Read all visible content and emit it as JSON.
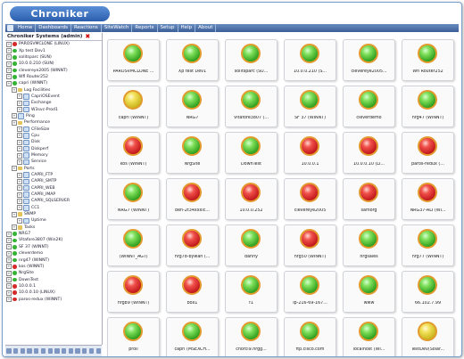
{
  "app": {
    "logo_text": "Chroniker"
  },
  "nav": {
    "items": [
      "Home",
      "Dashboards",
      "Reactions",
      "SiteWatch",
      "Reports",
      "Setup",
      "Help",
      "About"
    ]
  },
  "sidebar": {
    "title": "Chroniker Systems (admin)",
    "items": [
      {
        "label": "PAROSVMCLONE (LINUX)",
        "icon": "red",
        "depth": 0
      },
      {
        "label": "Xp test Dev1",
        "icon": "green",
        "depth": 0
      },
      {
        "label": "solitsparc (SUN)",
        "icon": "green",
        "depth": 0
      },
      {
        "label": "10.0.0.210 (SUN)",
        "icon": "green",
        "depth": 0
      },
      {
        "label": "clevereye2005 (WINNT)",
        "icon": "green",
        "depth": 0
      },
      {
        "label": "Wfl Router252",
        "icon": "green",
        "depth": 0
      },
      {
        "label": "capri (WINNT)",
        "icon": "green",
        "depth": 0
      },
      {
        "label": "Log Facilities",
        "icon": "folder",
        "depth": 1
      },
      {
        "label": "CapriOSEvent",
        "icon": "doc",
        "depth": 2
      },
      {
        "label": "Exchange",
        "icon": "doc",
        "depth": 2
      },
      {
        "label": "W3svc-Prod1",
        "icon": "doc",
        "depth": 2
      },
      {
        "label": "Ping",
        "icon": "doc",
        "depth": 1
      },
      {
        "label": "Performance",
        "icon": "folder",
        "depth": 1
      },
      {
        "label": "CFileSize",
        "icon": "doc",
        "depth": 2
      },
      {
        "label": "Cpu",
        "icon": "doc",
        "depth": 2
      },
      {
        "label": "Disk",
        "icon": "doc",
        "depth": 2
      },
      {
        "label": "Diskperf",
        "icon": "doc",
        "depth": 2
      },
      {
        "label": "Memory",
        "icon": "doc",
        "depth": 2
      },
      {
        "label": "Service",
        "icon": "doc",
        "depth": 2
      },
      {
        "label": "Ports",
        "icon": "folder",
        "depth": 1
      },
      {
        "label": "CAPRI_FTP",
        "icon": "doc",
        "depth": 2
      },
      {
        "label": "CAPRI_SMTP",
        "icon": "doc",
        "depth": 2
      },
      {
        "label": "CAPRI_WEB",
        "icon": "doc",
        "depth": 2
      },
      {
        "label": "CAPRI_IMAP",
        "icon": "doc",
        "depth": 2
      },
      {
        "label": "CAPRI_SQLSERVER",
        "icon": "doc",
        "depth": 2
      },
      {
        "label": "CC1",
        "icon": "doc",
        "depth": 2
      },
      {
        "label": "SNMP",
        "icon": "folder",
        "depth": 1
      },
      {
        "label": "Uptime",
        "icon": "doc",
        "depth": 2
      },
      {
        "label": "Tasks",
        "icon": "folder",
        "depth": 1
      },
      {
        "label": "NRG7",
        "icon": "green",
        "depth": 0
      },
      {
        "label": "Vitafore3807 (Win2K)",
        "icon": "green",
        "depth": 0
      },
      {
        "label": "SF 37 (WINNT)",
        "icon": "green",
        "depth": 0
      },
      {
        "label": "cleverdemo",
        "icon": "green",
        "depth": 0
      },
      {
        "label": "nrg47 (WINNT)",
        "icon": "green",
        "depth": 0
      },
      {
        "label": "kos (WINNT)",
        "icon": "red",
        "depth": 0
      },
      {
        "label": "NrgSite",
        "icon": "green",
        "depth": 0
      },
      {
        "label": "DownTest",
        "icon": "green",
        "depth": 0
      },
      {
        "label": "10.0.0.1",
        "icon": "red",
        "depth": 0
      },
      {
        "label": "10.0.0.10 (LINUX)",
        "icon": "red",
        "depth": 0
      },
      {
        "label": "paros-redux (WINNT)",
        "icon": "red",
        "depth": 0
      }
    ]
  },
  "devices": [
    [
      {
        "label": "PAROSVMCLONE ...",
        "status": "green"
      },
      {
        "label": "Xp test Dev1",
        "status": "green"
      },
      {
        "label": "solitsparc (SU...",
        "status": "green"
      },
      {
        "label": "10.0.0.210 (S...",
        "status": "green"
      },
      {
        "label": "clevereye2005...",
        "status": "green"
      },
      {
        "label": "Wfl Router252",
        "status": "green"
      }
    ],
    [
      {
        "label": "capri (WINNT)",
        "status": "yellow"
      },
      {
        "label": "NRG7",
        "status": "green"
      },
      {
        "label": "Vitafore3807 (...",
        "status": "green"
      },
      {
        "label": "SF 37 (WINNT)",
        "status": "green"
      },
      {
        "label": "cleverdemo",
        "status": "green"
      },
      {
        "label": "nrg47 (WINNT)",
        "status": "green"
      }
    ],
    [
      {
        "label": "kos (WINNT)",
        "status": "red"
      },
      {
        "label": "NrgSite",
        "status": "green"
      },
      {
        "label": "DownTest",
        "status": "green"
      },
      {
        "label": "10.0.0.1",
        "status": "red"
      },
      {
        "label": "10.0.0.10 (LI...",
        "status": "red"
      },
      {
        "label": "paros-redux (...",
        "status": "red"
      }
    ],
    [
      {
        "label": "NRG7 (WINNT)",
        "status": "green"
      },
      {
        "label": "ben-2t34xxxic...",
        "status": "red"
      },
      {
        "label": "10.0.0.252",
        "status": "red"
      },
      {
        "label": "clevereye2005",
        "status": "red"
      },
      {
        "label": "samorg",
        "status": "red"
      },
      {
        "label": "NRG37-ALI (WI...",
        "status": "red"
      }
    ],
    [
      {
        "label": "(WINNT_AGT)",
        "status": "green"
      },
      {
        "label": "nrg78-bywan (...",
        "status": "red"
      },
      {
        "label": "danny",
        "status": "green"
      },
      {
        "label": "nrg50 (WINNT)",
        "status": "red"
      },
      {
        "label": "nrgsales",
        "status": "green"
      },
      {
        "label": "nrg77 (WINNT)",
        "status": "green"
      }
    ],
    [
      {
        "label": "nrg89 (WINNT)",
        "status": "red"
      },
      {
        "label": "box1",
        "status": "red"
      },
      {
        "label": "f1",
        "status": "green"
      },
      {
        "label": "ip-216-69-167...",
        "status": "green"
      },
      {
        "label": "www",
        "status": "green"
      },
      {
        "label": "66.102.7.99",
        "status": "green"
      }
    ],
    [
      {
        "label": "proli",
        "status": "green"
      },
      {
        "label": "capri (MSEXCH...",
        "status": "green"
      },
      {
        "label": "chorcl9.nrgg...",
        "status": "green"
      },
      {
        "label": "ftp.cisco.com",
        "status": "green"
      },
      {
        "label": "localhost (WI...",
        "status": "green"
      },
      {
        "label": "TestDev(Solar...",
        "status": "yellow"
      }
    ]
  ],
  "colors": {
    "accent": "#3c5f98",
    "ring": "#e39a2e",
    "ok": "#2d9d1c",
    "error": "#c0161a",
    "warn": "#c9b41c"
  }
}
